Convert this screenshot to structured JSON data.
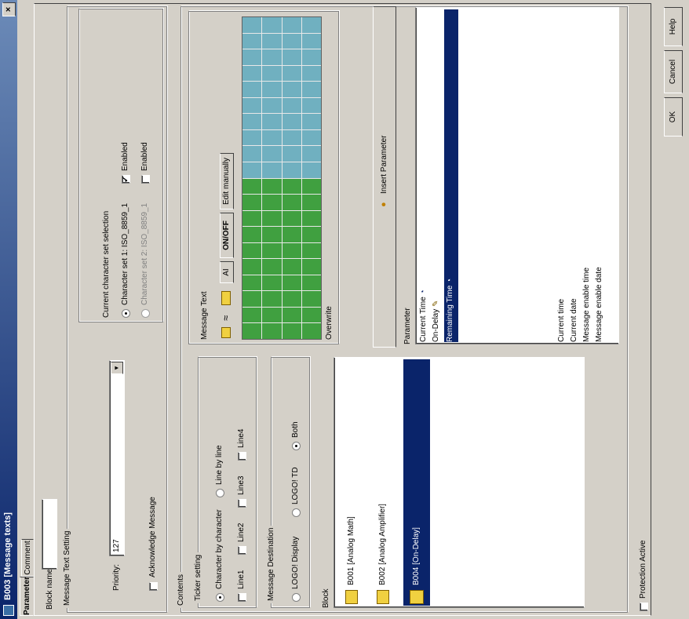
{
  "window": {
    "title": "B003 [Message texts]"
  },
  "tabs": {
    "parameter": "Parameter",
    "comment": "Comment"
  },
  "block_name": {
    "label": "Block name",
    "value": ""
  },
  "message_text_setting": {
    "label": "Message Text Setting",
    "priority_label": "Priority:",
    "priority_value": "127",
    "acknowledge_label": "Acknowledge Message",
    "charset_label": "Current character set selection",
    "charset1_label": "Character set 1: ISO_8859_1",
    "charset2_label": "Character set 2: ISO_8859_1",
    "enabled_label": "Enabled"
  },
  "contents": {
    "label": "Contents",
    "ticker": {
      "label": "Ticker setting",
      "by_char": "Character by character",
      "by_line": "Line by line",
      "lines": [
        "Line1",
        "Line2",
        "Line3",
        "Line4"
      ]
    },
    "destination": {
      "label": "Message Destination",
      "options": [
        "LOGO! Display",
        "LOGO! TD",
        "Both"
      ]
    },
    "message_text": {
      "label": "Message Text",
      "toolbar": {
        "ai": "AI",
        "onoff": "ON/OFF",
        "edit": "Edit manually"
      },
      "overwrite": "Overwrite"
    },
    "block": {
      "label": "Block",
      "items": [
        "B001 [Analog Math]",
        "B002 [Analog Amplifier]",
        "B004 [On-Delay]"
      ]
    },
    "insert_parameter": "Insert Parameter",
    "parameter": {
      "label": "Parameter",
      "items": [
        "Current Time",
        "On-Delay",
        "Remaining Time"
      ],
      "extra": [
        "Current time",
        "Current date",
        "Message enable time",
        "Message enable date"
      ]
    }
  },
  "protection": "Protection Active",
  "buttons": {
    "ok": "OK",
    "cancel": "Cancel",
    "help": "Help"
  }
}
